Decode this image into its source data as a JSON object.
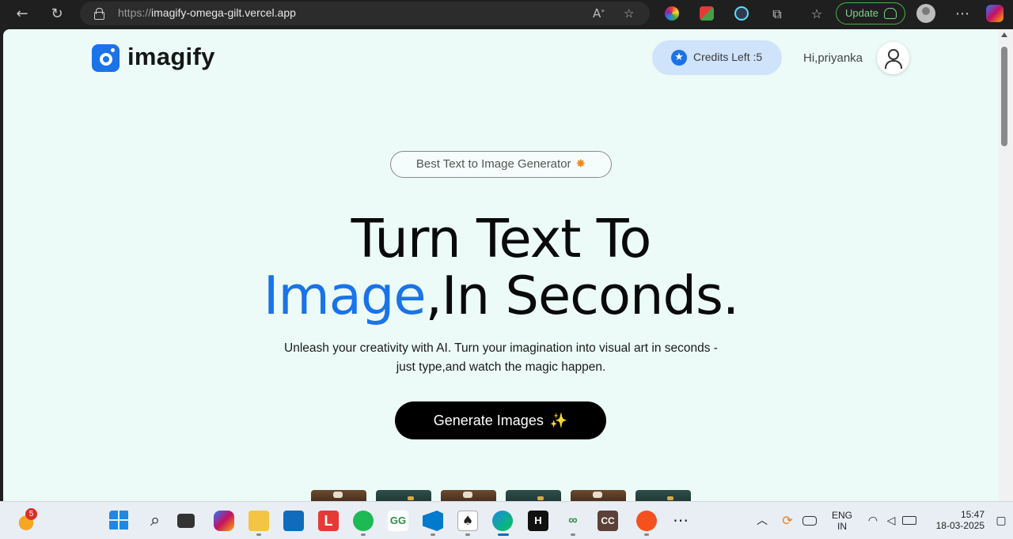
{
  "browser": {
    "url_prefix": "https://",
    "url_host": "imagify-omega-gilt.vercel.app",
    "update_label": "Update",
    "icons": {
      "back": "back-arrow-icon",
      "reload": "reload-icon",
      "read_aloud": "read-aloud-icon",
      "favorite": "favorite-star-icon",
      "more": "more-dots-icon"
    }
  },
  "header": {
    "logo_text": "imagify",
    "credits_label": "Credits Left :5",
    "greeting": "Hi,priyanka"
  },
  "hero": {
    "tag": "Best Text to Image Generator",
    "tag_spark": "✸",
    "title_line1": "Turn Text To",
    "title_blue": "Image",
    "title_line2_rest": ",In Seconds.",
    "subtitle_line1": "Unleash your creativity with AI. Turn your imagination into visual art in seconds -",
    "subtitle_line2": "just type,and watch the magic happen.",
    "cta_label": "Generate Images",
    "cta_spark": "✨"
  },
  "taskbar": {
    "weather_badge": "5",
    "lang_line1": "ENG",
    "lang_line2": "IN",
    "time": "15:47",
    "date": "18-03-2025"
  },
  "colors": {
    "accent": "#1a73e8",
    "page_bg": "#ecfbf7",
    "cta_bg": "#000000",
    "credits_bg": "#cfe3fb"
  }
}
